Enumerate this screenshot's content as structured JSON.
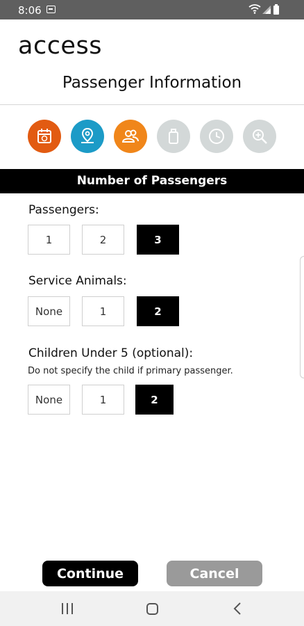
{
  "status_bar": {
    "time": "8:06"
  },
  "header": {
    "brand": "access",
    "title": "Passenger Information"
  },
  "steps": [
    {
      "name": "calendar",
      "state": "active",
      "color": "#e25b12"
    },
    {
      "name": "location",
      "state": "active",
      "color": "#1c9bc7"
    },
    {
      "name": "passengers",
      "state": "active",
      "color": "#f0861a"
    },
    {
      "name": "luggage",
      "state": "inactive",
      "color": "#d3d8d8"
    },
    {
      "name": "clock",
      "state": "inactive",
      "color": "#d3d8d8"
    },
    {
      "name": "review",
      "state": "inactive",
      "color": "#d3d8d8"
    }
  ],
  "section": {
    "title": "Number of Passengers"
  },
  "passengers": {
    "label": "Passengers:",
    "options": [
      "1",
      "2",
      "3"
    ],
    "selected": "3"
  },
  "service_animals": {
    "label": "Service Animals:",
    "options": [
      "None",
      "1",
      "2"
    ],
    "selected": "2"
  },
  "children": {
    "label": "Children Under 5 (optional):",
    "hint": "Do not specify the child if primary passenger.",
    "options": [
      "None",
      "1",
      "2"
    ],
    "selected": "2"
  },
  "actions": {
    "continue": "Continue",
    "cancel": "Cancel"
  },
  "colors": {
    "selected_bg": "#000000",
    "cancel_bg": "#9a9a9a"
  }
}
